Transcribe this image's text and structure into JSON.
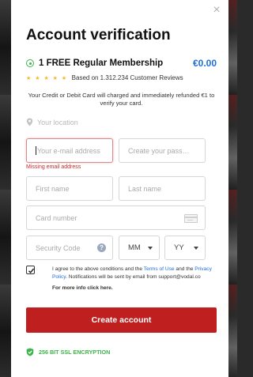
{
  "modal": {
    "title": "Account verification",
    "close_glyph": "×"
  },
  "plan": {
    "name": "1 FREE Regular Membership",
    "price": "€0.00",
    "icon": "radio-selected-icon"
  },
  "rating": {
    "stars": "★ ★ ★ ★ ★",
    "text": "Based on 1.312.234 Customer Reviews"
  },
  "notice": "Your Credit or Debit Card will charged and immediately refunded €1 to verify your card.",
  "location": {
    "placeholder": "Your location"
  },
  "fields": {
    "email_placeholder": "Your e-mail address",
    "password_placeholder": "Create your pass…",
    "email_error": "Missing email address",
    "first_name_placeholder": "First name",
    "last_name_placeholder": "Last name",
    "card_number_placeholder": "Card number",
    "security_code_placeholder": "Security Code",
    "security_help": "?",
    "month_value": "MM",
    "year_value": "YY",
    "date_separator": "/"
  },
  "terms": {
    "prefix": "I agree to the above conditions and the ",
    "terms_link": "Terms of Use",
    "and": " and the ",
    "privacy_link": "Privacy Policy",
    "suffix": ". Notifications will be sent by email from support@vodal.co",
    "checked": true,
    "more_info": "For more info click here."
  },
  "submit_label": "Create account",
  "ssl_label": "256 BIT SSL ENCRYPTION",
  "colors": {
    "accent_blue": "#1e6fd9",
    "button_red": "#c01f1f",
    "success_green": "#3cb44a",
    "error_red": "#c62828",
    "star_yellow": "#f5b82e"
  }
}
